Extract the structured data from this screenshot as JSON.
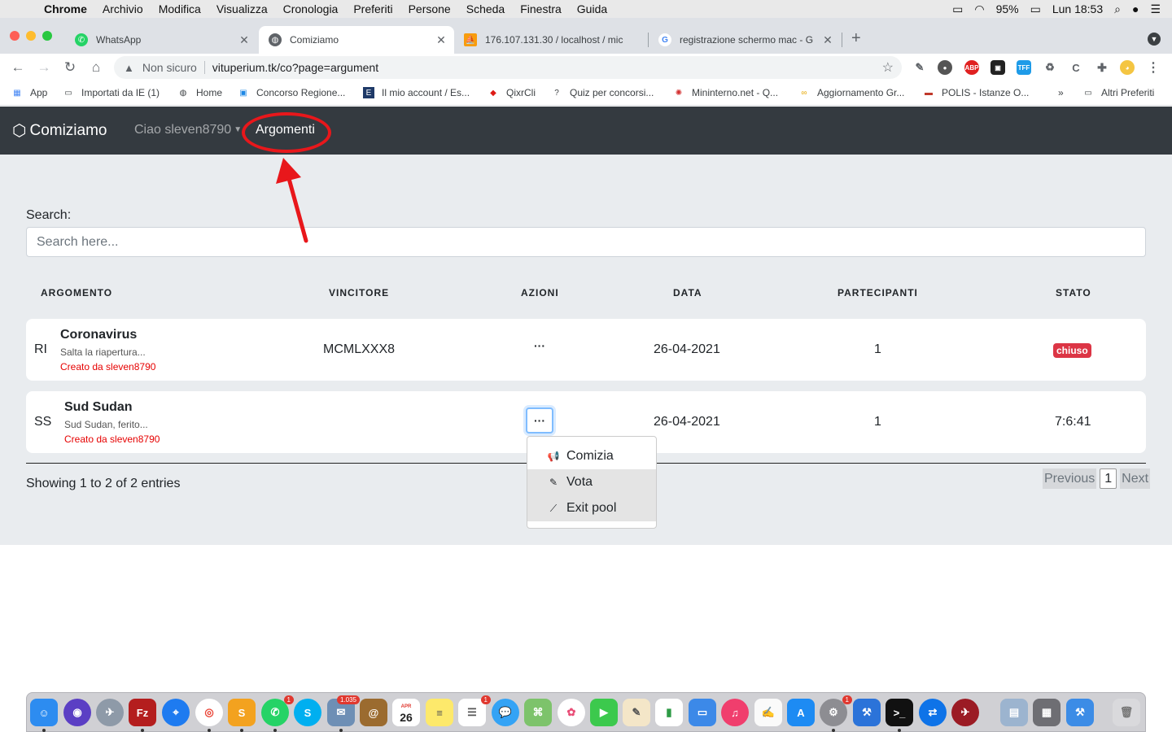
{
  "menubar": {
    "app": "Chrome",
    "items": [
      "Archivio",
      "Modifica",
      "Visualizza",
      "Cronologia",
      "Preferiti",
      "Persone",
      "Scheda",
      "Finestra",
      "Guida"
    ],
    "battery": "95%",
    "clock": "Lun 18:53"
  },
  "tabs": [
    {
      "title": "WhatsApp",
      "icon": "whatsapp-icon",
      "active": false
    },
    {
      "title": "Comiziamo",
      "icon": "globe-icon",
      "active": true
    },
    {
      "title": "176.107.131.30 / localhost / mic",
      "icon": "phpmyadmin-icon",
      "active": false
    },
    {
      "title": "registrazione schermo mac - G",
      "icon": "google-icon",
      "active": false
    }
  ],
  "toolbar": {
    "security": "Non sicuro",
    "url": "vituperium.tk/co?page=argument"
  },
  "bookmarks": {
    "items": [
      "App",
      "Importati da IE (1)",
      "Home",
      "Concorso Regione...",
      "Il mio account / Es...",
      "QixrCli",
      "Quiz per concorsi...",
      "Mininterno.net - Q...",
      "Aggiornamento Gr...",
      "POLIS - Istanze O..."
    ],
    "more": "»",
    "other": "Altri Preferiti"
  },
  "navbar": {
    "brand": "Comiziamo",
    "user": "Ciao sleven8790",
    "link": "Argomenti"
  },
  "search": {
    "label": "Search:",
    "placeholder": "Search here..."
  },
  "table": {
    "headers": [
      "ARGOMENTO",
      "VINCITORE",
      "AZIONI",
      "DATA",
      "PARTECIPANTI",
      "STATO"
    ],
    "rows": [
      {
        "abbr": "RI",
        "title": "Coronavirus",
        "subtitle": "Salta la riapertura...",
        "creator": "Creato da sleven8790",
        "winner": "MCMLXXX8",
        "actions": "···",
        "date": "26-04-2021",
        "participants": "1",
        "status": "chiuso"
      },
      {
        "abbr": "SS",
        "title": "Sud Sudan",
        "subtitle": "Sud Sudan, ferito...",
        "creator": "Creato da sleven8790",
        "winner": "",
        "actions": "···",
        "date": "26-04-2021",
        "participants": "1",
        "status": "7:6:41"
      }
    ]
  },
  "dropdown": {
    "items": [
      {
        "label": "Comizia",
        "icon": "megaphone-icon"
      },
      {
        "label": "Vota",
        "icon": "pencil-icon"
      },
      {
        "label": "Exit pool",
        "icon": "chart-line-icon"
      }
    ]
  },
  "footer": {
    "entries": "Showing 1 to 2 of 2 entries",
    "previous": "Previous",
    "current_page": "1",
    "next": "Next"
  },
  "dock": {
    "badges": {
      "whatsapp": "1",
      "skype": "",
      "mail": "1.035",
      "calendar_month": "APR",
      "calendar_day": "26",
      "reminders": "1",
      "settings": "1"
    }
  },
  "colors": {
    "navbar_bg": "#343a40",
    "content_bg": "#e9ecef",
    "highlight_red": "#e8171b",
    "badge_red": "#dc3545",
    "creator_red": "#e60000"
  }
}
